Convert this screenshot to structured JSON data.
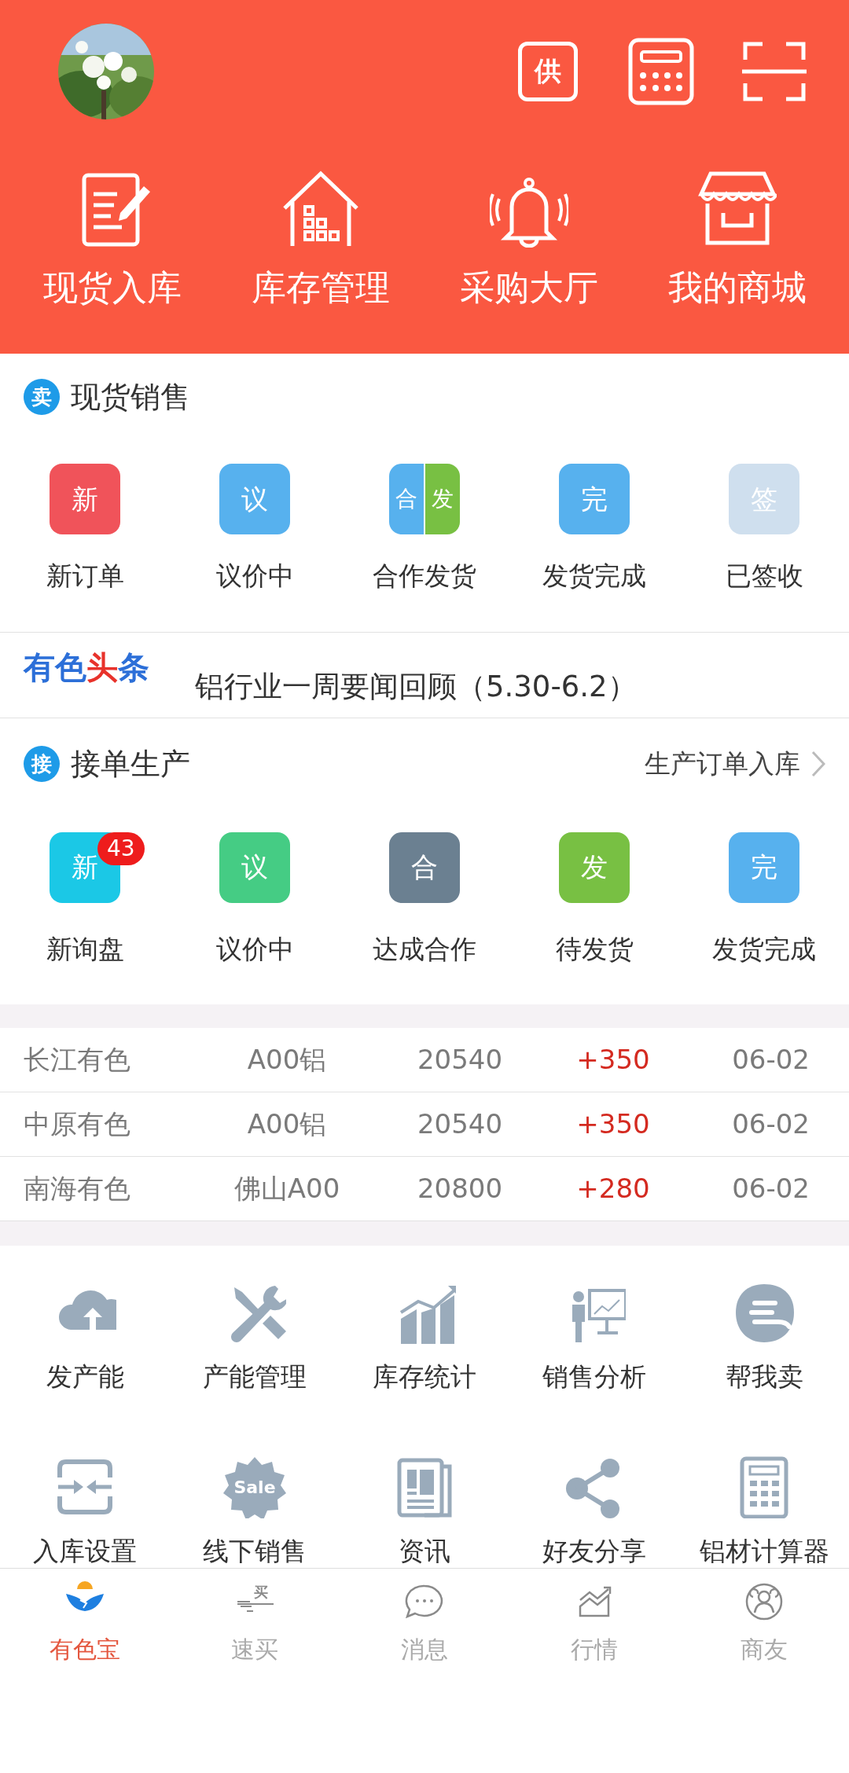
{
  "header": {
    "supply_label": "供",
    "quick_actions": [
      {
        "label": "现货入库"
      },
      {
        "label": "库存管理"
      },
      {
        "label": "采购大厅"
      },
      {
        "label": "我的商城"
      }
    ]
  },
  "spot_sales": {
    "badge": "卖",
    "title": "现货销售",
    "items": [
      {
        "kind": "tile",
        "tile": "新",
        "color": "#f0535a",
        "label": "新订单"
      },
      {
        "kind": "tile",
        "tile": "议",
        "color": "#57b1ee",
        "label": "议价中"
      },
      {
        "kind": "split",
        "parts": [
          {
            "tile": "合",
            "color": "#57b1ee"
          },
          {
            "tile": "发",
            "color": "#78c043"
          }
        ],
        "label": "合作发货"
      },
      {
        "kind": "tile",
        "tile": "完",
        "color": "#57b1ee",
        "label": "发货完成"
      },
      {
        "kind": "tile",
        "tile": "签",
        "color": "#cfdfee",
        "label": "已签收"
      }
    ]
  },
  "news": {
    "logo": [
      {
        "text": "有色",
        "color": "#2c6fd8"
      },
      {
        "text": "头",
        "color": "#e8322b"
      },
      {
        "text": "条",
        "color": "#2c6fd8"
      }
    ],
    "headline": "铝行业一周要闻回顾（5.30-6.2）"
  },
  "production": {
    "badge": "接",
    "title": "接单生产",
    "link": "生产订单入库",
    "items": [
      {
        "tile": "新",
        "color": "#1bc8e6",
        "label": "新询盘",
        "count": "43"
      },
      {
        "tile": "议",
        "color": "#45cc84",
        "label": "议价中"
      },
      {
        "tile": "合",
        "color": "#6b8091",
        "label": "达成合作"
      },
      {
        "tile": "发",
        "color": "#78c043",
        "label": "待发货"
      },
      {
        "tile": "完",
        "color": "#57b1ee",
        "label": "发货完成"
      }
    ]
  },
  "prices": {
    "rows": [
      {
        "market": "长江有色",
        "product": "A00铝",
        "price": "20540",
        "change": "+350",
        "date": "06-02"
      },
      {
        "market": "中原有色",
        "product": "A00铝",
        "price": "20540",
        "change": "+350",
        "date": "06-02"
      },
      {
        "market": "南海有色",
        "product": "佛山A00",
        "price": "20800",
        "change": "+280",
        "date": "06-02"
      }
    ]
  },
  "tools": [
    {
      "label": "发产能"
    },
    {
      "label": "产能管理"
    },
    {
      "label": "库存统计"
    },
    {
      "label": "销售分析"
    },
    {
      "label": "帮我卖"
    },
    {
      "label": "入库设置"
    },
    {
      "label": "线下销售",
      "icon_text": "Sale"
    },
    {
      "label": "资讯"
    },
    {
      "label": "好友分享"
    },
    {
      "label": "铝材计算器"
    }
  ],
  "tab_bar": [
    {
      "label": "有色宝",
      "selected": true
    },
    {
      "label": "速买",
      "selected": false,
      "icon_text": "买"
    },
    {
      "label": "消息",
      "selected": false
    },
    {
      "label": "行情",
      "selected": false
    },
    {
      "label": "商友",
      "selected": false
    }
  ]
}
